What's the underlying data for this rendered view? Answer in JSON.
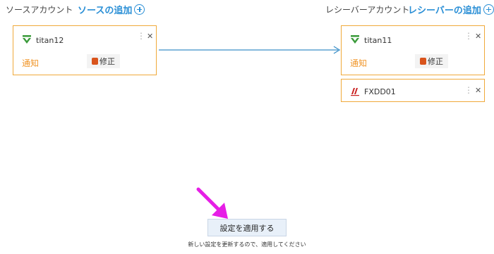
{
  "header": {
    "source_label": "ソースアカウント",
    "source_add": "ソースの追加",
    "receiver_label": "レシーバーアカウント",
    "receiver_add": "レシーバーの追加"
  },
  "source_accounts": [
    {
      "name": "titan12",
      "notify": "通知",
      "modify": "修正",
      "icon": "v-shield-icon"
    }
  ],
  "receiver_accounts": [
    {
      "name": "titan11",
      "notify": "通知",
      "modify": "修正",
      "icon": "v-shield-icon"
    },
    {
      "name": "FXDD01",
      "icon": "fxdd-logo-icon"
    }
  ],
  "apply": {
    "button_label": "設定を適用する",
    "note": "新しい設定を更新するので、適用してください"
  },
  "colors": {
    "accent": "#2a8fd6",
    "card_border": "#f0a93a",
    "notify": "#f0962a",
    "connector": "#3a8fc8",
    "pointer_arrow": "#e61ee6"
  }
}
